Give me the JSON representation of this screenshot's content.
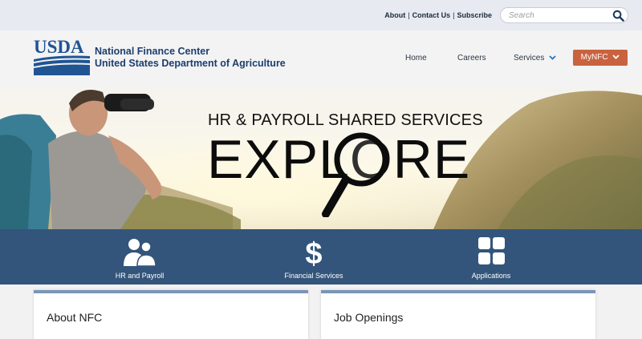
{
  "utility": {
    "links": [
      "About",
      "Contact Us",
      "Subscribe"
    ],
    "separator": "|",
    "search_placeholder": "Search",
    "search_icon": "search-icon"
  },
  "header": {
    "logo_text": "USDA",
    "org_line1": "National Finance Center",
    "org_line2": "United States Department of Agriculture",
    "nav": {
      "home": "Home",
      "careers": "Careers",
      "services": "Services",
      "mynfc": "MyNFC"
    }
  },
  "hero": {
    "tagline": "HR & PAYROLL SHARED SERVICES",
    "headline": "EXPLORE"
  },
  "services": [
    {
      "label": "HR and Payroll",
      "icon": "people-icon"
    },
    {
      "label": "Financial Services",
      "icon": "dollar-icon"
    },
    {
      "label": "Applications",
      "icon": "apps-grid-icon"
    }
  ],
  "cards": {
    "about_title": "About NFC",
    "jobs_title": "Job Openings"
  },
  "colors": {
    "usda_blue": "#205493",
    "strip_blue": "#34557b",
    "mynfc_orange": "#c9633f",
    "card_border": "#7a96b8"
  }
}
